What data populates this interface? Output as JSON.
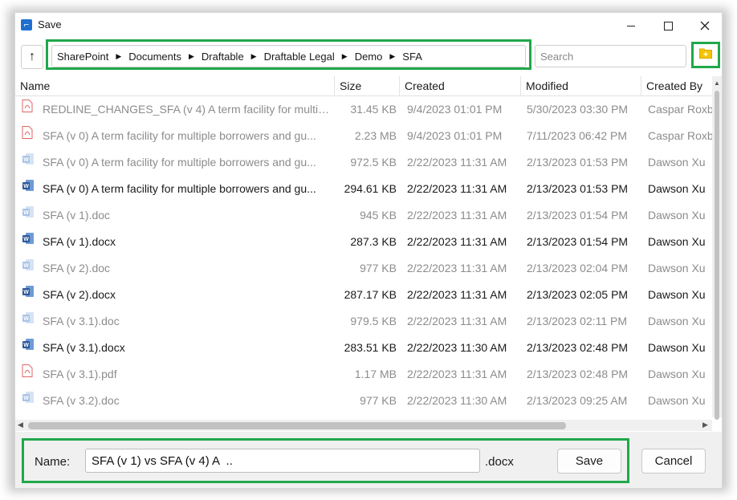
{
  "window": {
    "title": "Save"
  },
  "breadcrumb": [
    "SharePoint",
    "Documents",
    "Draftable",
    "Draftable Legal",
    "Demo",
    "SFA"
  ],
  "search": {
    "placeholder": "Search",
    "value": ""
  },
  "columns": {
    "name": "Name",
    "size": "Size",
    "created": "Created",
    "modified": "Modified",
    "created_by": "Created By"
  },
  "files": [
    {
      "type": "pdf",
      "state": "dim",
      "name": "REDLINE_CHANGES_SFA (v 4) A term facility for multip...",
      "size": "31.45 KB",
      "created": "9/4/2023 01:01 PM",
      "modified": "5/30/2023 03:30 PM",
      "created_by": "Caspar Roxb"
    },
    {
      "type": "pdf",
      "state": "dim",
      "name": "SFA (v 0) A term facility for multiple borrowers and gu...",
      "size": "2.23 MB",
      "created": "9/4/2023 01:01 PM",
      "modified": "7/11/2023 06:42 PM",
      "created_by": "Caspar Roxb"
    },
    {
      "type": "doc",
      "state": "dim",
      "name": "SFA (v 0) A term facility for multiple borrowers and gu...",
      "size": "972.5 KB",
      "created": "2/22/2023 11:31 AM",
      "modified": "2/13/2023 01:53 PM",
      "created_by": "Dawson Xu"
    },
    {
      "type": "docx",
      "state": "strong",
      "name": "SFA (v 0) A term facility for multiple borrowers and gu...",
      "size": "294.61 KB",
      "created": "2/22/2023 11:31 AM",
      "modified": "2/13/2023 01:53 PM",
      "created_by": "Dawson Xu"
    },
    {
      "type": "doc",
      "state": "dim",
      "name": "SFA (v 1).doc",
      "size": "945 KB",
      "created": "2/22/2023 11:31 AM",
      "modified": "2/13/2023 01:54 PM",
      "created_by": "Dawson Xu"
    },
    {
      "type": "docx",
      "state": "strong",
      "name": "SFA (v 1).docx",
      "size": "287.3 KB",
      "created": "2/22/2023 11:31 AM",
      "modified": "2/13/2023 01:54 PM",
      "created_by": "Dawson Xu"
    },
    {
      "type": "doc",
      "state": "dim",
      "name": "SFA (v 2).doc",
      "size": "977 KB",
      "created": "2/22/2023 11:31 AM",
      "modified": "2/13/2023 02:04 PM",
      "created_by": "Dawson Xu"
    },
    {
      "type": "docx",
      "state": "strong",
      "name": "SFA (v 2).docx",
      "size": "287.17 KB",
      "created": "2/22/2023 11:31 AM",
      "modified": "2/13/2023 02:05 PM",
      "created_by": "Dawson Xu"
    },
    {
      "type": "doc",
      "state": "dim",
      "name": "SFA (v 3.1).doc",
      "size": "979.5 KB",
      "created": "2/22/2023 11:31 AM",
      "modified": "2/13/2023 02:11 PM",
      "created_by": "Dawson Xu"
    },
    {
      "type": "docx",
      "state": "strong",
      "name": "SFA (v 3.1).docx",
      "size": "283.51 KB",
      "created": "2/22/2023 11:30 AM",
      "modified": "2/13/2023 02:48 PM",
      "created_by": "Dawson Xu"
    },
    {
      "type": "pdf",
      "state": "dim",
      "name": "SFA (v 3.1).pdf",
      "size": "1.17 MB",
      "created": "2/22/2023 11:31 AM",
      "modified": "2/13/2023 02:48 PM",
      "created_by": "Dawson Xu"
    },
    {
      "type": "doc",
      "state": "dim",
      "name": "SFA (v 3.2).doc",
      "size": "977 KB",
      "created": "2/22/2023 11:30 AM",
      "modified": "2/13/2023 09:25 AM",
      "created_by": "Dawson Xu"
    }
  ],
  "footer": {
    "name_label": "Name:",
    "file_name": "SFA (v 1) vs SFA (v 4) A  ..",
    "extension": ".docx",
    "save_label": "Save",
    "cancel_label": "Cancel"
  },
  "icons": {
    "app": "save-dialog-icon",
    "up": "up-arrow-icon",
    "new_folder": "new-folder-icon",
    "pdf": "pdf-file-icon",
    "doc": "word-file-icon"
  },
  "colors": {
    "highlight": "#20a84a",
    "folder": "#f5c400",
    "word": "#2b579a",
    "pdf": "#e06666"
  }
}
